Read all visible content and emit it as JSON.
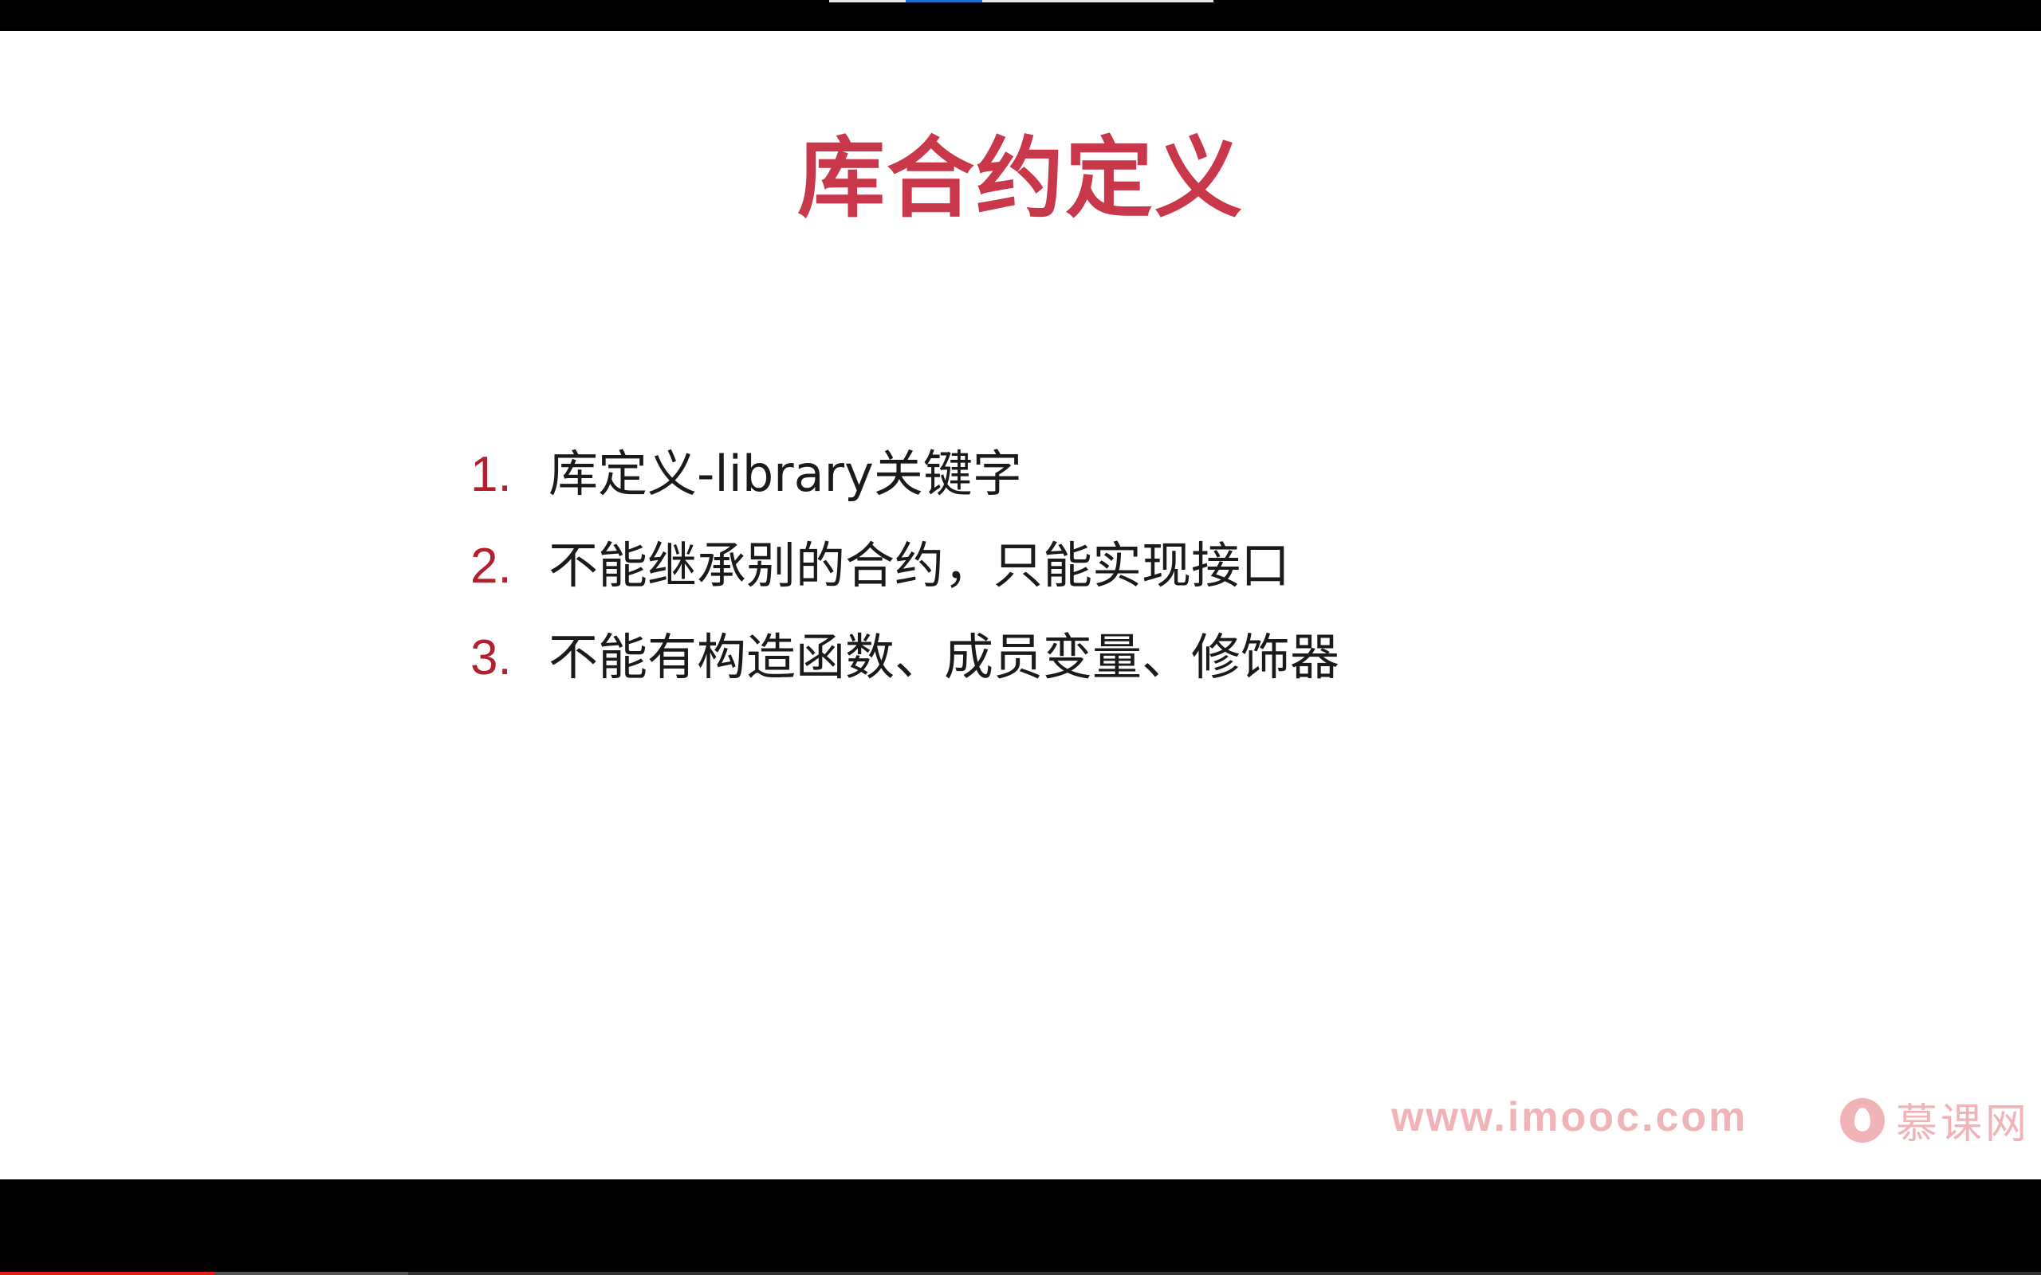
{
  "slide": {
    "title": "库合约定义",
    "items": [
      {
        "number": "1.",
        "text": "库定义-library关键字"
      },
      {
        "number": "2.",
        "text": "不能继承别的合约，只能实现接口"
      },
      {
        "number": "3.",
        "text": "不能有构造函数、成员变量、修饰器"
      }
    ]
  },
  "watermark": {
    "url": "www.imooc.com",
    "brand": "慕课网",
    "logo_icon": "imooc-flame-icon"
  },
  "player": {
    "progress_played": 0.105,
    "progress_buffered": 0.2,
    "progress_color": "#e02020"
  },
  "colors": {
    "title": "#c9374b",
    "bullet_number": "#b3202d",
    "watermark": "#f0b4b8"
  }
}
